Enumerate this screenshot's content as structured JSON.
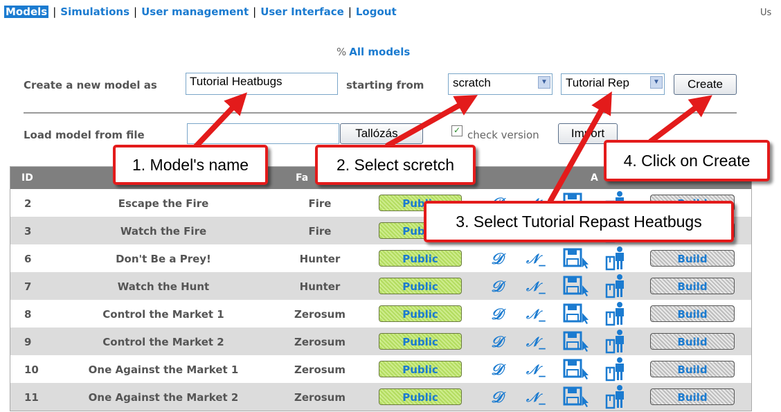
{
  "nav": {
    "items": [
      "Models",
      "Simulations",
      "User management",
      "User Interface",
      "Logout"
    ],
    "user_corner": "Us"
  },
  "all_models": {
    "label": "All models",
    "icon": "percent-icon"
  },
  "create_form": {
    "label": "Create a new model as",
    "name_value": "Tutorial Heatbugs",
    "starting_label": "starting from",
    "start_select": "scratch",
    "template_select": "Tutorial Rep",
    "create_button": "Create"
  },
  "load_form": {
    "label": "Load model from file",
    "browse_button": "Tallózás...",
    "check_label": "check version",
    "import_button": "Import"
  },
  "table": {
    "headers": {
      "id": "ID",
      "family": "Fa",
      "actions": "A"
    },
    "rows": [
      {
        "id": "2",
        "name": "Escape the Fire",
        "family": "Fire",
        "status": "Public",
        "build": "Build"
      },
      {
        "id": "3",
        "name": "Watch the Fire",
        "family": "Fire",
        "status": "Public",
        "build": "Build"
      },
      {
        "id": "6",
        "name": "Don't Be a Prey!",
        "family": "Hunter",
        "status": "Public",
        "build": "Build"
      },
      {
        "id": "7",
        "name": "Watch the Hunt",
        "family": "Hunter",
        "status": "Public",
        "build": "Build"
      },
      {
        "id": "8",
        "name": "Control the Market 1",
        "family": "Zerosum",
        "status": "Public",
        "build": "Build"
      },
      {
        "id": "9",
        "name": "Control the Market 2",
        "family": "Zerosum",
        "status": "Public",
        "build": "Build"
      },
      {
        "id": "10",
        "name": "One Against the Market 1",
        "family": "Zerosum",
        "status": "Public",
        "build": "Build"
      },
      {
        "id": "11",
        "name": "One Against the Market 2",
        "family": "Zerosum",
        "status": "Public",
        "build": "Build"
      }
    ],
    "icons": {
      "d": "𝒟",
      "n": "𝒩_"
    }
  },
  "callouts": {
    "c1": "1. Model's name",
    "c2": "2. Select scretch",
    "c3": "3. Select Tutorial Repast Heatbugs",
    "c4": "4. Click on Create"
  },
  "colors": {
    "link": "#1b7bd0",
    "callout_border": "#e31b1b",
    "header_bg": "#7f7f7f",
    "alt_row": "#dcdcdc"
  }
}
